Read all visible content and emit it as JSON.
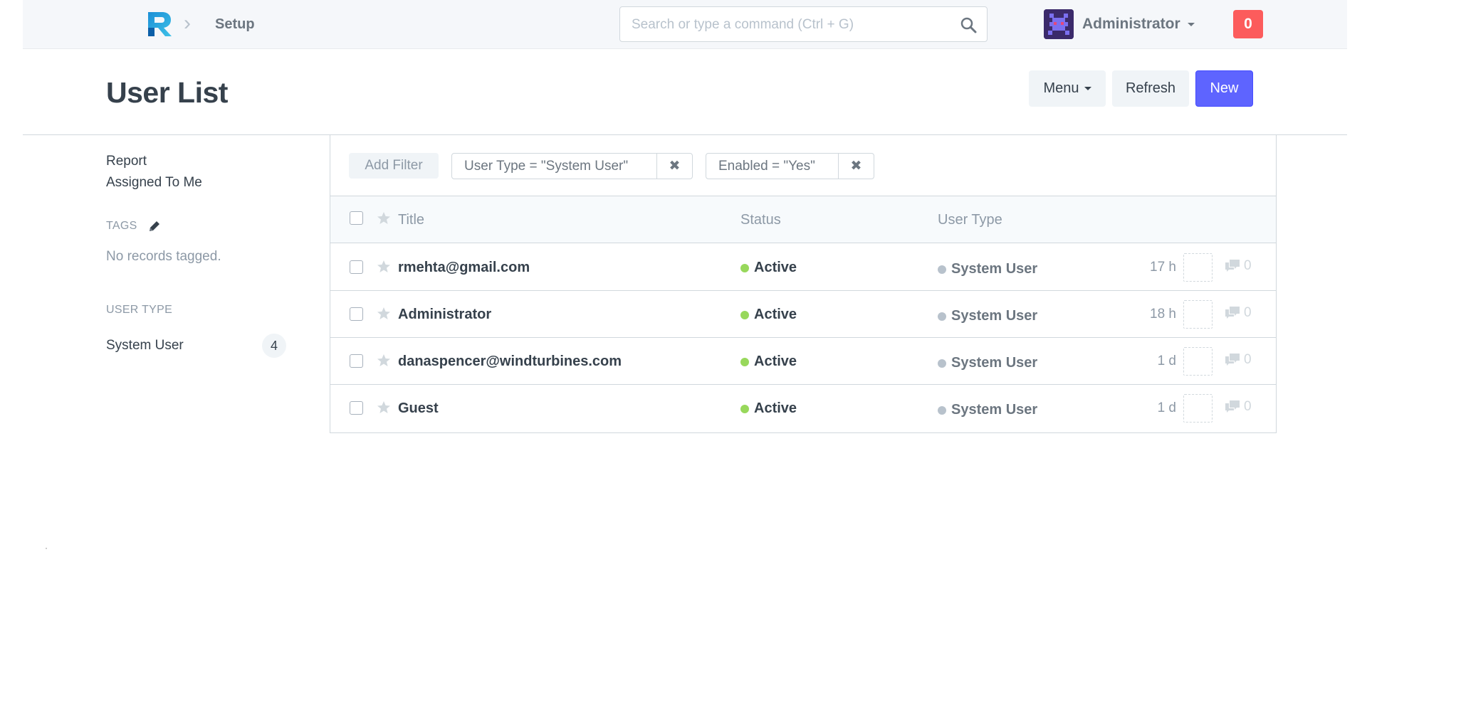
{
  "navbar": {
    "breadcrumb": "Setup",
    "search_placeholder": "Search or type a command (Ctrl + G)",
    "user_name": "Administrator",
    "notification_count": "0"
  },
  "page": {
    "title": "User List",
    "menu_label": "Menu",
    "refresh_label": "Refresh",
    "new_label": "New"
  },
  "sidebar": {
    "links": [
      "Report",
      "Assigned To Me"
    ],
    "tags_heading": "TAGS",
    "no_tags_text": "No records tagged.",
    "user_type_heading": "USER TYPE",
    "user_type_item": {
      "label": "System User",
      "count": "4"
    }
  },
  "filters": {
    "add_filter_label": "Add Filter",
    "active": [
      {
        "label": "User Type = \"System User\""
      },
      {
        "label": "Enabled = \"Yes\""
      }
    ]
  },
  "list": {
    "columns": {
      "title": "Title",
      "status": "Status",
      "user_type": "User Type"
    },
    "rows": [
      {
        "title": "rmehta@gmail.com",
        "status": "Active",
        "user_type": "System User",
        "time": "17 h",
        "comments": "0"
      },
      {
        "title": "Administrator",
        "status": "Active",
        "user_type": "System User",
        "time": "18 h",
        "comments": "0"
      },
      {
        "title": "danaspencer@windturbines.com",
        "status": "Active",
        "user_type": "System User",
        "time": "1 d",
        "comments": "0"
      },
      {
        "title": "Guest",
        "status": "Active",
        "user_type": "System User",
        "time": "1 d",
        "comments": "0"
      }
    ]
  },
  "colors": {
    "primary": "#5e64ff",
    "status_active": "#98d85b",
    "user_type_dot": "#b8c2cc",
    "notification": "#fc5c5c"
  }
}
